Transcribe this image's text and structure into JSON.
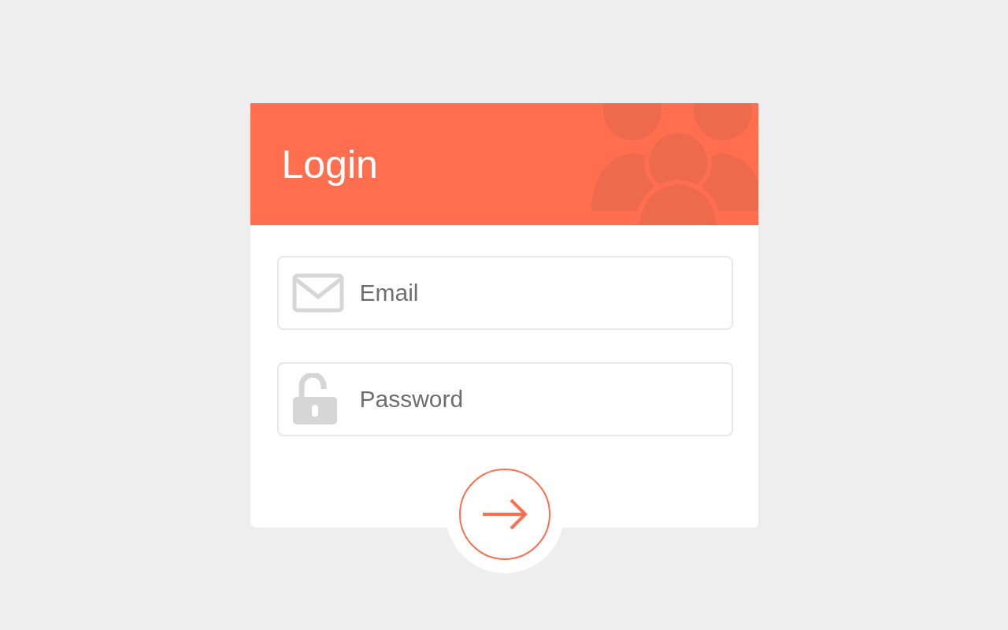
{
  "header": {
    "title": "Login"
  },
  "fields": [
    {
      "kind": "email",
      "placeholder": "Email"
    },
    {
      "kind": "password",
      "placeholder": "Password"
    }
  ]
}
